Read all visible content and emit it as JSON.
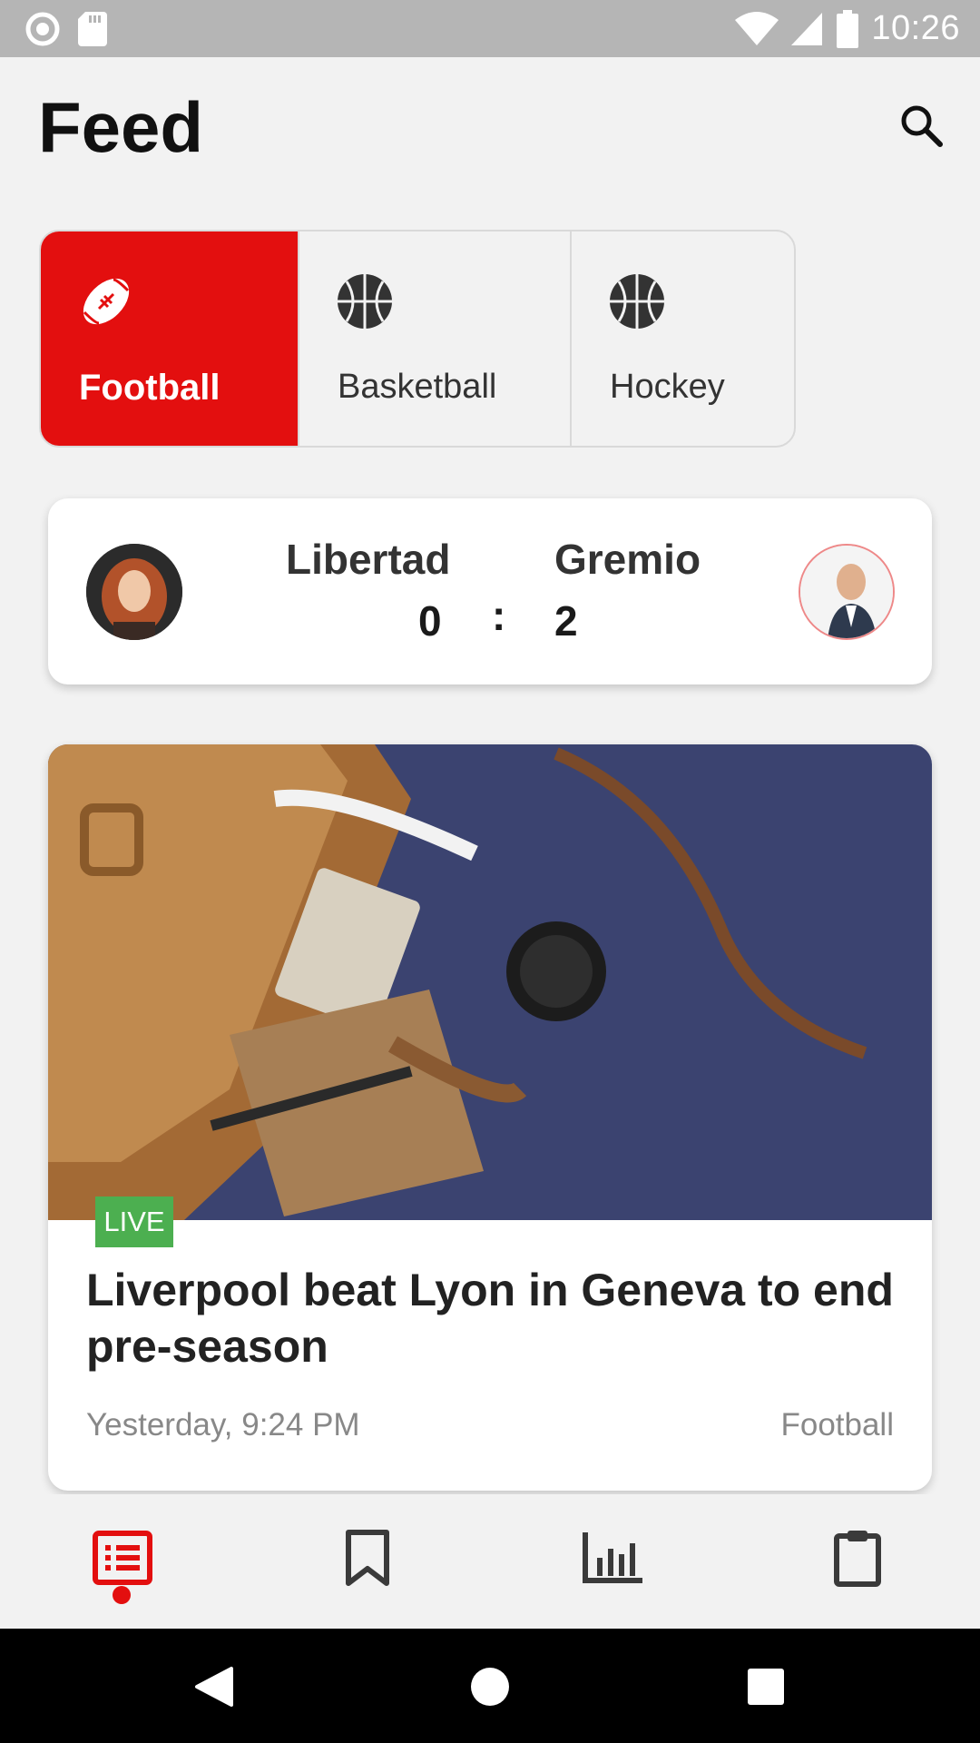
{
  "status_bar": {
    "time": "10:26",
    "icons": [
      "circle-notification-icon",
      "sd-card-icon",
      "wifi-icon",
      "signal-icon",
      "battery-icon"
    ]
  },
  "header": {
    "title": "Feed",
    "search_icon": "search-icon"
  },
  "sport_tabs": [
    {
      "label": "Football",
      "icon": "american-football-icon",
      "active": true
    },
    {
      "label": "Basketball",
      "icon": "basketball-icon",
      "active": false
    },
    {
      "label": "Hockey",
      "icon": "basketball-icon",
      "active": false
    }
  ],
  "match": {
    "home_team": "Libertad",
    "away_team": "Gremio",
    "home_score": "0",
    "away_score": "2",
    "separator": ":"
  },
  "news": {
    "badge": "LIVE",
    "headline": "Liverpool beat Lyon in Geneva to end pre-season",
    "time": "Yesterday, 9:24 PM",
    "category": "Football"
  },
  "bottom_nav": {
    "items": [
      {
        "icon": "feed-list-icon",
        "active": true
      },
      {
        "icon": "bookmark-icon",
        "active": false
      },
      {
        "icon": "bar-chart-icon",
        "active": false
      },
      {
        "icon": "clipboard-icon",
        "active": false
      }
    ]
  },
  "colors": {
    "accent": "#e30f0f",
    "live": "#4caf50",
    "background": "#f2f2f2",
    "status_bar": "#b5b5b5"
  }
}
